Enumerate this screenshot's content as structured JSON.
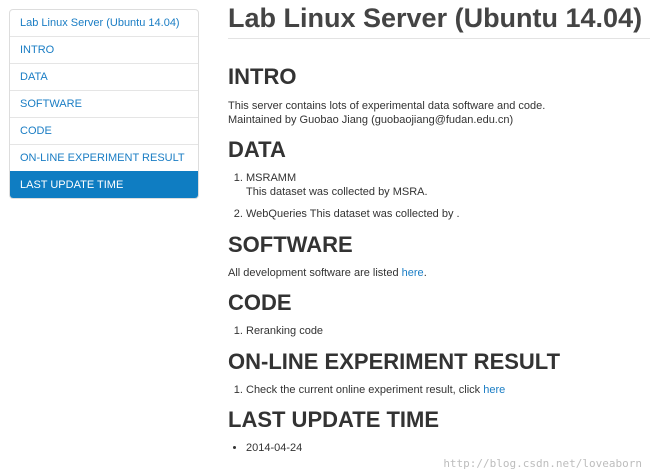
{
  "sidebar": {
    "items": [
      {
        "label": "Lab Linux Server (Ubuntu 14.04)"
      },
      {
        "label": "INTRO"
      },
      {
        "label": "DATA"
      },
      {
        "label": "SOFTWARE"
      },
      {
        "label": "CODE"
      },
      {
        "label": "ON-LINE EXPERIMENT RESULT"
      },
      {
        "label": "LAST UPDATE TIME"
      }
    ]
  },
  "page": {
    "title": "Lab Linux Server (Ubuntu 14.04)"
  },
  "sections": {
    "intro": {
      "heading": "INTRO",
      "line1": "This server contains lots of experimental data software and code.",
      "line2": "Maintained by Guobao Jiang (guobaojiang@fudan.edu.cn)"
    },
    "data": {
      "heading": "DATA",
      "item1_name": "MSRAMM",
      "item1_desc": "This dataset was collected by MSRA.",
      "item2": "WebQueries This dataset was collected by ."
    },
    "software": {
      "heading": "SOFTWARE",
      "text": "All development software are listed ",
      "link": "here",
      "suffix": "."
    },
    "code": {
      "heading": "CODE",
      "item1": "Reranking code"
    },
    "online": {
      "heading": "ON-LINE EXPERIMENT RESULT",
      "item1_text": "Check the current online experiment result, click ",
      "item1_link": "here"
    },
    "last_update": {
      "heading": "LAST UPDATE TIME",
      "date": "2014-04-24"
    }
  },
  "watermark": "http://blog.csdn.net/loveaborn",
  "colors": {
    "link": "#1a7dc4",
    "active_bg": "#0f7dc2",
    "text": "#333333"
  }
}
